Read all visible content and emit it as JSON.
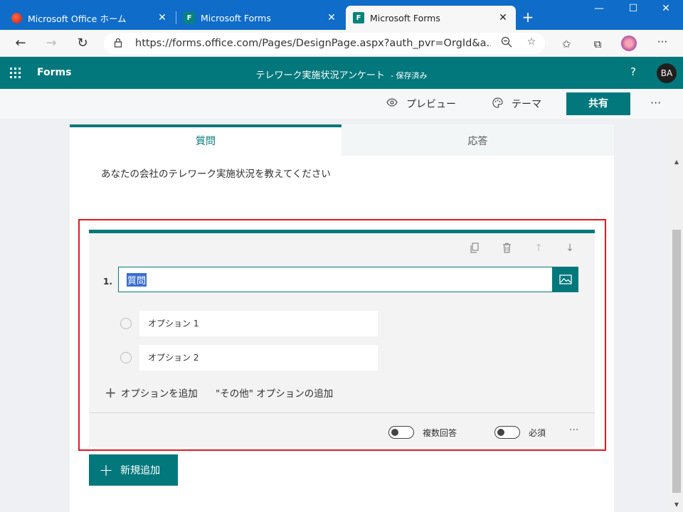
{
  "browser": {
    "tabs": [
      {
        "title": "Microsoft Office ホーム",
        "close": "✕"
      },
      {
        "title": "Microsoft Forms",
        "close": "✕"
      },
      {
        "title": "Microsoft Forms",
        "close": "✕"
      }
    ],
    "url": "https://forms.office.com/Pages/DesignPage.aspx?auth_pvr=OrgId&a..."
  },
  "app": {
    "name": "Forms",
    "form_title": "テレワーク実施状況アンケート",
    "saved_status": "- 保存済み",
    "help": "?",
    "avatar_initials": "BA"
  },
  "commands": {
    "preview": "プレビュー",
    "theme": "テーマ",
    "share": "共有",
    "more": "···"
  },
  "panel": {
    "tabs": {
      "questions": "質問",
      "responses": "応答"
    },
    "description": "あなたの会社のテレワーク実施状況を教えてください"
  },
  "question": {
    "number": "1.",
    "title": "質問",
    "options": [
      "オプション 1",
      "オプション 2"
    ],
    "add_option": "オプションを追加",
    "add_other": "\"その他\" オプションの追加",
    "multiple_answers": "複数回答",
    "required": "必須",
    "more": "···"
  },
  "add_new": "新規追加",
  "colors": {
    "brand": "#03787c",
    "browser_blue": "#0f6cc9",
    "highlight": "#e0191f"
  }
}
